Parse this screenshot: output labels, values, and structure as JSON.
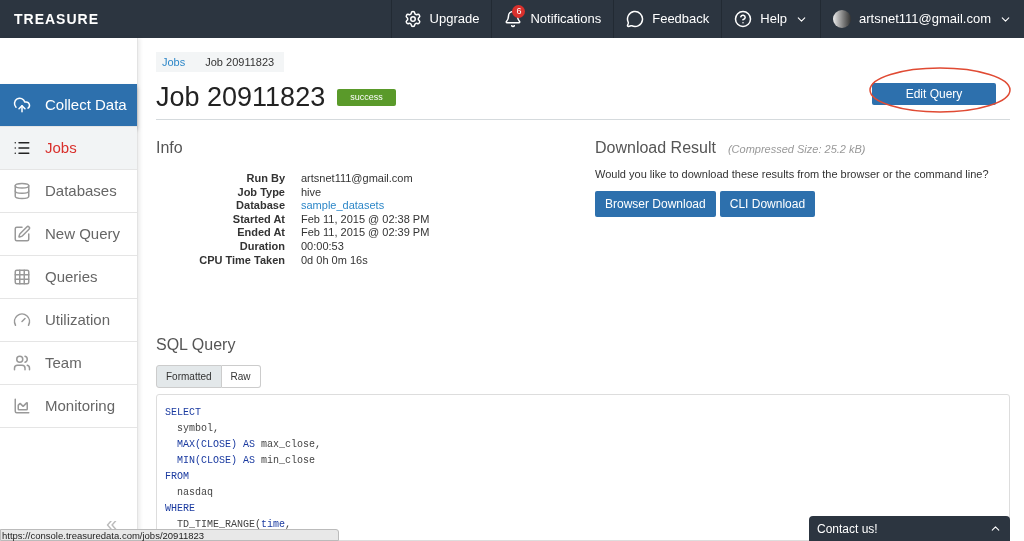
{
  "topbar": {
    "logo": "TREASURE",
    "items": [
      {
        "kind": "upgrade",
        "label": "Upgrade"
      },
      {
        "kind": "notifications",
        "label": "Notifications",
        "badge": "6"
      },
      {
        "kind": "feedback",
        "label": "Feedback"
      },
      {
        "kind": "help",
        "label": "Help",
        "dropdown": true
      },
      {
        "kind": "user",
        "label": "artsnet111@gmail.com",
        "dropdown": true
      }
    ]
  },
  "sidebar": {
    "items": [
      {
        "kind": "collect",
        "label": "Collect Data",
        "selected": false,
        "highlighted": true
      },
      {
        "kind": "jobs",
        "label": "Jobs",
        "selected": true,
        "highlighted": false
      },
      {
        "kind": "databases",
        "label": "Databases",
        "selected": false,
        "highlighted": false
      },
      {
        "kind": "query",
        "label": "New Query",
        "selected": false,
        "highlighted": false
      },
      {
        "kind": "queries",
        "label": "Queries",
        "selected": false,
        "highlighted": false
      },
      {
        "kind": "utilization",
        "label": "Utilization",
        "selected": false,
        "highlighted": false
      },
      {
        "kind": "team",
        "label": "Team",
        "selected": false,
        "highlighted": false
      },
      {
        "kind": "monitoring",
        "label": "Monitoring",
        "selected": false,
        "highlighted": false
      }
    ],
    "collapse": "«"
  },
  "breadcrumb": [
    "Jobs",
    "Job 20911823"
  ],
  "title": "Job 20911823",
  "status": "success",
  "edit_button": "Edit Query",
  "info": {
    "heading": "Info",
    "rows": [
      {
        "label": "Run By",
        "value": "artsnet111@gmail.com",
        "link": false
      },
      {
        "label": "Job Type",
        "value": "hive",
        "link": false
      },
      {
        "label": "Database",
        "value": "sample_datasets",
        "link": true
      },
      {
        "label": "Started At",
        "value": "Feb 11, 2015 @ 02:38 PM",
        "link": false
      },
      {
        "label": "Ended At",
        "value": "Feb 11, 2015 @ 02:39 PM",
        "link": false
      },
      {
        "label": "Duration",
        "value": "00:00:53",
        "link": false
      },
      {
        "label": "CPU Time Taken",
        "value": "0d 0h 0m 16s",
        "link": false
      }
    ]
  },
  "download": {
    "heading": "Download Result",
    "size": "(Compressed Size: 25.2 kB)",
    "question": "Would you like to download these results from the browser or the command line?",
    "buttons": [
      "Browser Download",
      "CLI Download"
    ]
  },
  "sql": {
    "heading": "SQL Query",
    "tabs": [
      {
        "label": "Formatted",
        "selected": true
      },
      {
        "label": "Raw",
        "selected": false
      }
    ],
    "lines": [
      [
        {
          "kind": "keyword",
          "text": "SELECT"
        }
      ],
      [
        {
          "kind": "plain",
          "text": "  symbol,"
        }
      ],
      [
        {
          "kind": "keyword",
          "text": "  MAX(CLOSE) AS"
        },
        {
          "kind": "plain",
          "text": " max_close,"
        }
      ],
      [
        {
          "kind": "keyword",
          "text": "  MIN(CLOSE) AS"
        },
        {
          "kind": "plain",
          "text": " min_close"
        }
      ],
      [
        {
          "kind": "keyword",
          "text": "FROM"
        }
      ],
      [
        {
          "kind": "plain",
          "text": "  nasdaq"
        }
      ],
      [
        {
          "kind": "keyword",
          "text": "WHERE"
        }
      ],
      [
        {
          "kind": "plain",
          "text": "  TD_TIME_RANGE("
        },
        {
          "kind": "keyword",
          "text": "time"
        },
        {
          "kind": "plain",
          "text": ","
        }
      ]
    ]
  },
  "status_url": "https://console.treasuredata.com/jobs/20911823",
  "contact": "Contact us!"
}
